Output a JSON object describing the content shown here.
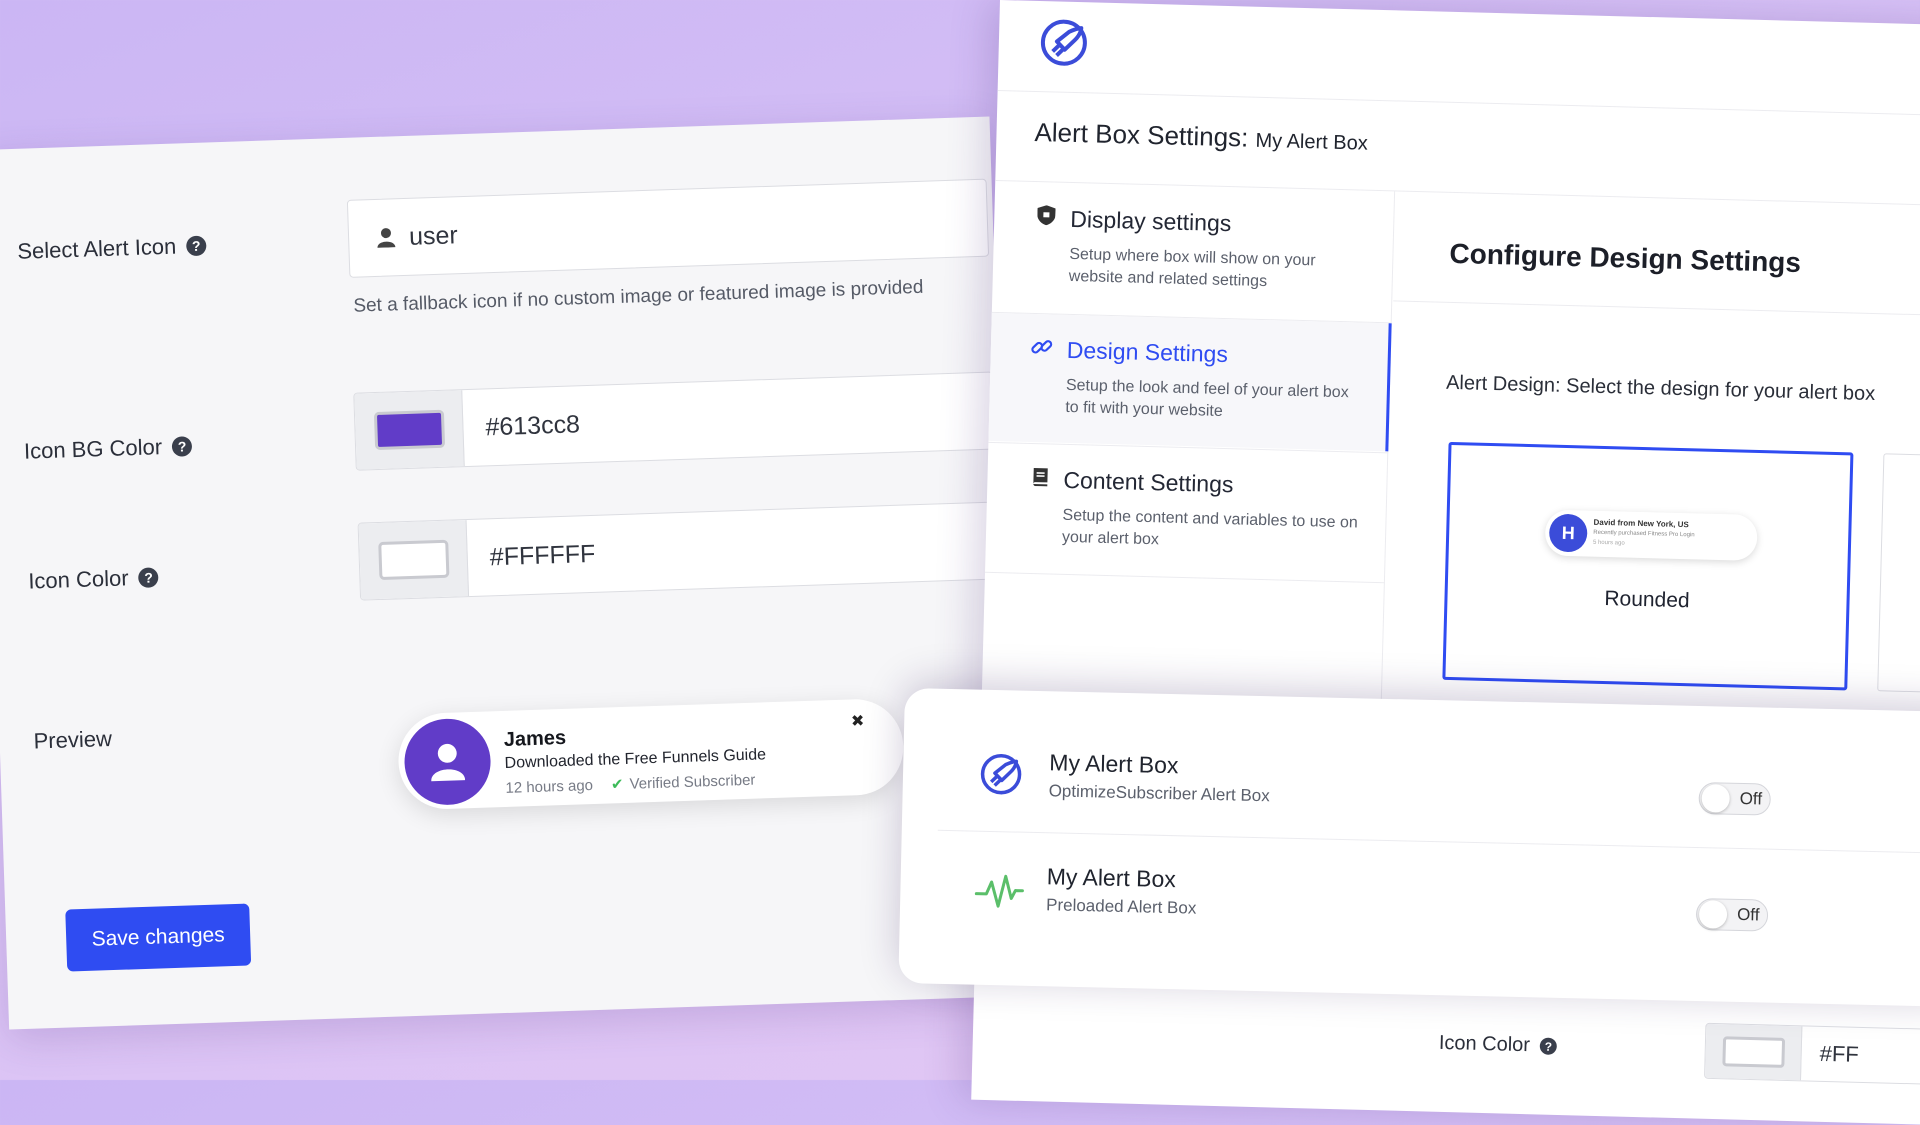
{
  "left": {
    "alert_icon": {
      "label": "Select Alert Icon",
      "value": "user",
      "hint": "Set a fallback icon if no custom image or featured image is provided"
    },
    "icon_bg": {
      "label": "Icon BG Color",
      "value": "#613cc8",
      "swatch": "#613cc8"
    },
    "icon_color": {
      "label": "Icon Color",
      "value": "#FFFFFF",
      "swatch": "#FFFFFF"
    },
    "preview": {
      "label": "Preview",
      "name": "James",
      "action": "Downloaded the Free Funnels Guide",
      "time": "12 hours ago",
      "verified": "Verified Subscriber"
    },
    "save_label": "Save changes",
    "help_glyph": "?"
  },
  "right": {
    "header": {
      "title": "Alert Box Settings:",
      "subtitle": "My Alert Box"
    },
    "nav": [
      {
        "title": "Display settings",
        "desc": "Setup where box will show on your website and related settings",
        "icon": "shield-icon"
      },
      {
        "title": "Design Settings",
        "desc": "Setup the look and feel of your alert box to fit with your website",
        "icon": "link-icon",
        "active": true
      },
      {
        "title": "Content Settings",
        "desc": "Setup the content and variables to use on your alert box",
        "icon": "book-icon"
      }
    ],
    "main_title": "Configure Design Settings",
    "design_label": "Alert Design: Select the design for your alert box",
    "design_option": {
      "name": "Rounded",
      "mini_title": "David from New York, US",
      "mini_line": "Recently purchased Fitness Pro Login",
      "mini_time": "5 hours ago"
    },
    "bottom_field": {
      "label": "Icon Color",
      "value": "#FF"
    }
  },
  "boxes": [
    {
      "name": "My Alert Box",
      "type": "OptimizeSubscriber Alert Box",
      "toggle": "Off",
      "icon": "rocket-icon"
    },
    {
      "name": "My Alert Box",
      "type": "Preloaded Alert Box",
      "toggle": "Off",
      "icon": "pulse-icon"
    }
  ],
  "colors": {
    "accent": "#2f4cf2",
    "brand_purple": "#613cc8",
    "pulse_green": "#5bbf6a"
  },
  "check_glyph": "✔",
  "close_glyph": "✖"
}
